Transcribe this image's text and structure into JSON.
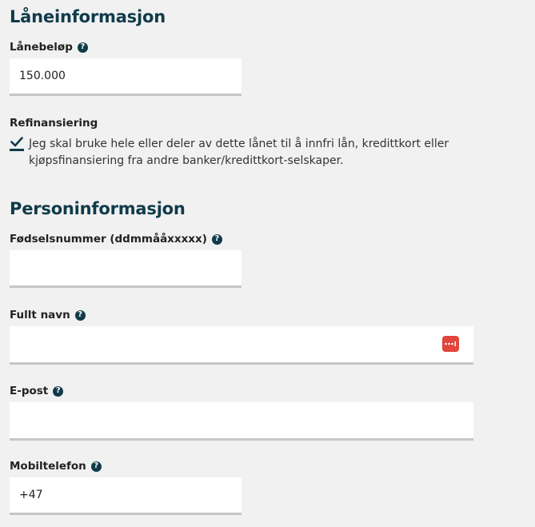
{
  "loan_section": {
    "title": "Låneinformasjon",
    "amount_label": "Lånebeløp",
    "amount_value": "150.000",
    "refinancing_label": "Refinansiering",
    "refinancing_text": "Jeg skal bruke hele eller deler av dette lånet til å innfri lån, kredittkort eller kjøpsfinansiering fra andre banker/kredittkort-selskaper.",
    "refinancing_checked": true
  },
  "person_section": {
    "title": "Personinformasjon",
    "ssn_label": "Fødselsnummer (ddmmååxxxxx)",
    "ssn_value": "",
    "name_label": "Fullt navn",
    "name_value": "",
    "email_label": "E-post",
    "email_value": "",
    "phone_label": "Mobiltelefon",
    "phone_value": "+47"
  },
  "icons": {
    "help": "question-circle-icon",
    "password_manager": "password-manager-icon",
    "check": "checkmark-icon"
  },
  "colors": {
    "heading": "#0f3b4a",
    "background": "#f1f1f1",
    "field_underline": "#c6c6c6",
    "password_manager": "#e2453b"
  }
}
